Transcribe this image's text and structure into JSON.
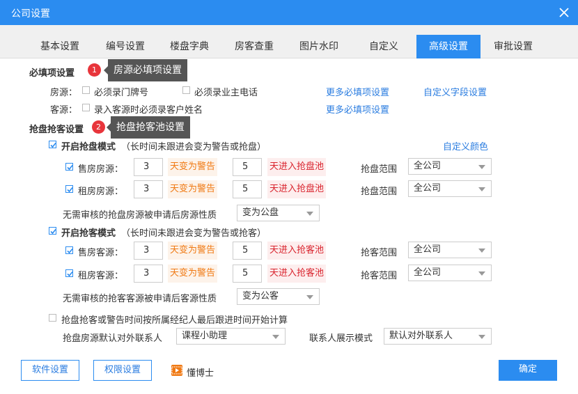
{
  "window": {
    "title": "公司设置"
  },
  "tabs": [
    {
      "label": "基本设置"
    },
    {
      "label": "编号设置"
    },
    {
      "label": "楼盘字典"
    },
    {
      "label": "房客查重"
    },
    {
      "label": "图片水印"
    },
    {
      "label": "自定义"
    },
    {
      "label": "高级设置",
      "active": true
    },
    {
      "label": "审批设置"
    }
  ],
  "required": {
    "title": "必填项设置",
    "badge": "1",
    "tooltip": "房源必填项设置",
    "house_label": "房源：",
    "house_opt1": "必须录门牌号",
    "house_opt2": "必须录业主电话",
    "house_more": "更多必填项设置",
    "custom_fields": "自定义字段设置",
    "client_label": "客源：",
    "client_opt1": "录入客源时必须录客户姓名",
    "client_more": "更多必填项设置"
  },
  "grab": {
    "title": "抢盘抢客设置",
    "badge": "2",
    "tooltip": "抢盘抢客池设置",
    "custom_color": "自定义颜色",
    "house_mode": "开启抢盘模式",
    "house_mode_note": "（长时间未跟进会变为警告或抢盘）",
    "sale_house": "售房房源：",
    "rent_house": "租房房源：",
    "warn_days_sale_house": "3",
    "pool_days_sale_house": "5",
    "warn_days_rent_house": "3",
    "pool_days_rent_house": "5",
    "warn_text": "天变为警告",
    "house_pool_text": "天进入抢盘池",
    "house_range_label": "抢盘范围",
    "house_range_sale": "全公司",
    "house_range_rent": "全公司",
    "house_apply_label": "无需审核的抢盘房源被申请后房源性质",
    "house_apply_value": "变为公盘",
    "client_mode": "开启抢客模式",
    "client_mode_note": "（长时间未跟进会变为警告或抢客）",
    "sale_client": "售房客源：",
    "rent_client": "租房客源：",
    "warn_days_sale_client": "3",
    "pool_days_sale_client": "5",
    "warn_days_rent_client": "3",
    "pool_days_rent_client": "5",
    "client_pool_text": "天进入抢客池",
    "client_range_label": "抢客范围",
    "client_range_sale": "全公司",
    "client_range_rent": "全公司",
    "client_apply_label": "无需审核的抢客客源被申请后客源性质",
    "client_apply_value": "变为公客",
    "time_rule": "抢盘抢客或警告时间按所属经纪人最后跟进时间开始计算",
    "default_contact_label": "抢盘房源默认对外联系人",
    "default_contact_value": "课程小助理",
    "contact_mode_label": "联系人展示模式",
    "contact_mode_value": "默认对外联系人"
  },
  "footer": {
    "software_settings": "软件设置",
    "permission_settings": "权限设置",
    "brand": "懂博士",
    "confirm": "确定"
  },
  "colors": {
    "accent": "#2b8cf0",
    "warning": "#f07a14",
    "danger": "#d9232d"
  }
}
